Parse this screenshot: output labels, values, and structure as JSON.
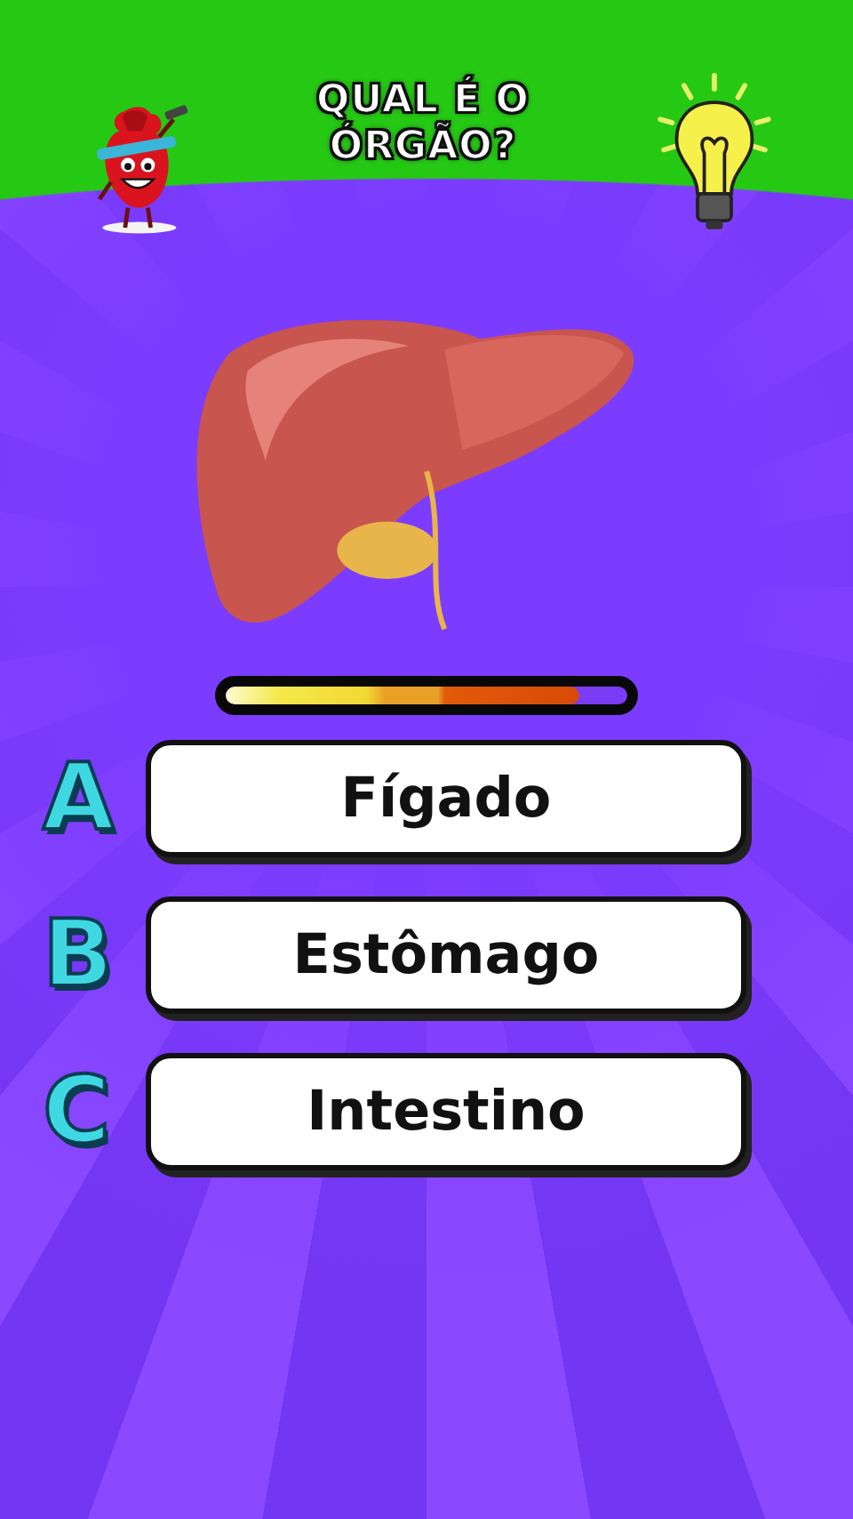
{
  "header": {
    "title_lines": [
      "QUAL É O",
      "ÓRGÃO?"
    ]
  },
  "timer": {
    "level": 0.88
  },
  "answers": [
    {
      "letter": "A",
      "text": "Fígado"
    },
    {
      "letter": "B",
      "text": "Estômago"
    },
    {
      "letter": "C",
      "text": "Intestino"
    }
  ]
}
